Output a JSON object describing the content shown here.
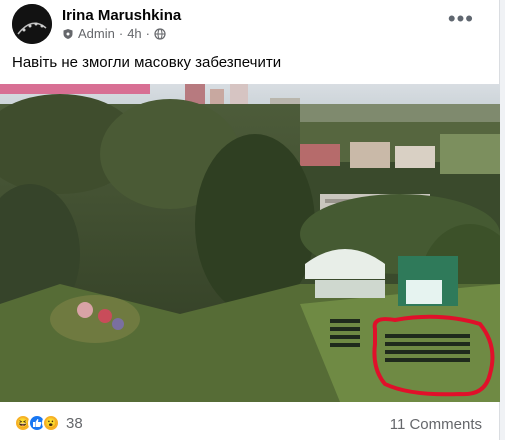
{
  "post": {
    "author": "Irina Marushkina",
    "role": "Admin",
    "separator": "·",
    "time": "4h",
    "separator2": "·",
    "privacy_icon": "globe-icon",
    "role_icon": "shield-admin-icon",
    "text": "Навіть не змогли масовку забезпечити"
  },
  "media": {
    "description_icon": "aerial-photo-image",
    "highlight_color": "#e0102a"
  },
  "footer": {
    "reactions": [
      "haha-icon",
      "like-icon",
      "wow-icon"
    ],
    "reaction_count": "38",
    "comments_label": "11 Comments"
  }
}
